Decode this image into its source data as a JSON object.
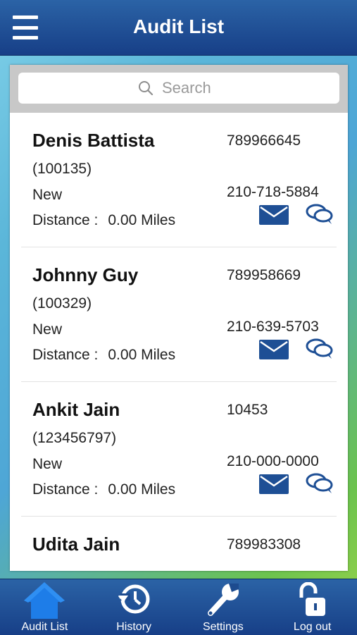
{
  "header": {
    "title": "Audit List",
    "menu_icon": "hamburger-menu-icon"
  },
  "search": {
    "placeholder": "Search",
    "icon": "search-icon"
  },
  "audits": [
    {
      "name": "Denis Battista",
      "id": "(100135)",
      "status": "New",
      "distance_label": "Distance :",
      "distance_value": "0.00 Miles",
      "account": "789966645",
      "phone": "210-718-5884"
    },
    {
      "name": "Johnny Guy",
      "id": "(100329)",
      "status": "New",
      "distance_label": "Distance :",
      "distance_value": "0.00 Miles",
      "account": "789958669",
      "phone": "210-639-5703"
    },
    {
      "name": "Ankit Jain",
      "id": "(123456797)",
      "status": "New",
      "distance_label": "Distance :",
      "distance_value": "0.00 Miles",
      "account": "10453",
      "phone": "210-000-0000"
    },
    {
      "name": "Udita Jain",
      "id": "",
      "status": "",
      "distance_label": "",
      "distance_value": "",
      "account": "789983308",
      "phone": ""
    }
  ],
  "tabs": [
    {
      "label": "Audit List",
      "icon": "home-icon",
      "active": true
    },
    {
      "label": "History",
      "icon": "history-icon",
      "active": false
    },
    {
      "label": "Settings",
      "icon": "wrench-icon",
      "active": false
    },
    {
      "label": "Log out",
      "icon": "unlock-icon",
      "active": false
    }
  ],
  "colors": {
    "bar": "#1c4a92",
    "accent": "#1f5aa8",
    "active_tab": "#1e7de8"
  }
}
